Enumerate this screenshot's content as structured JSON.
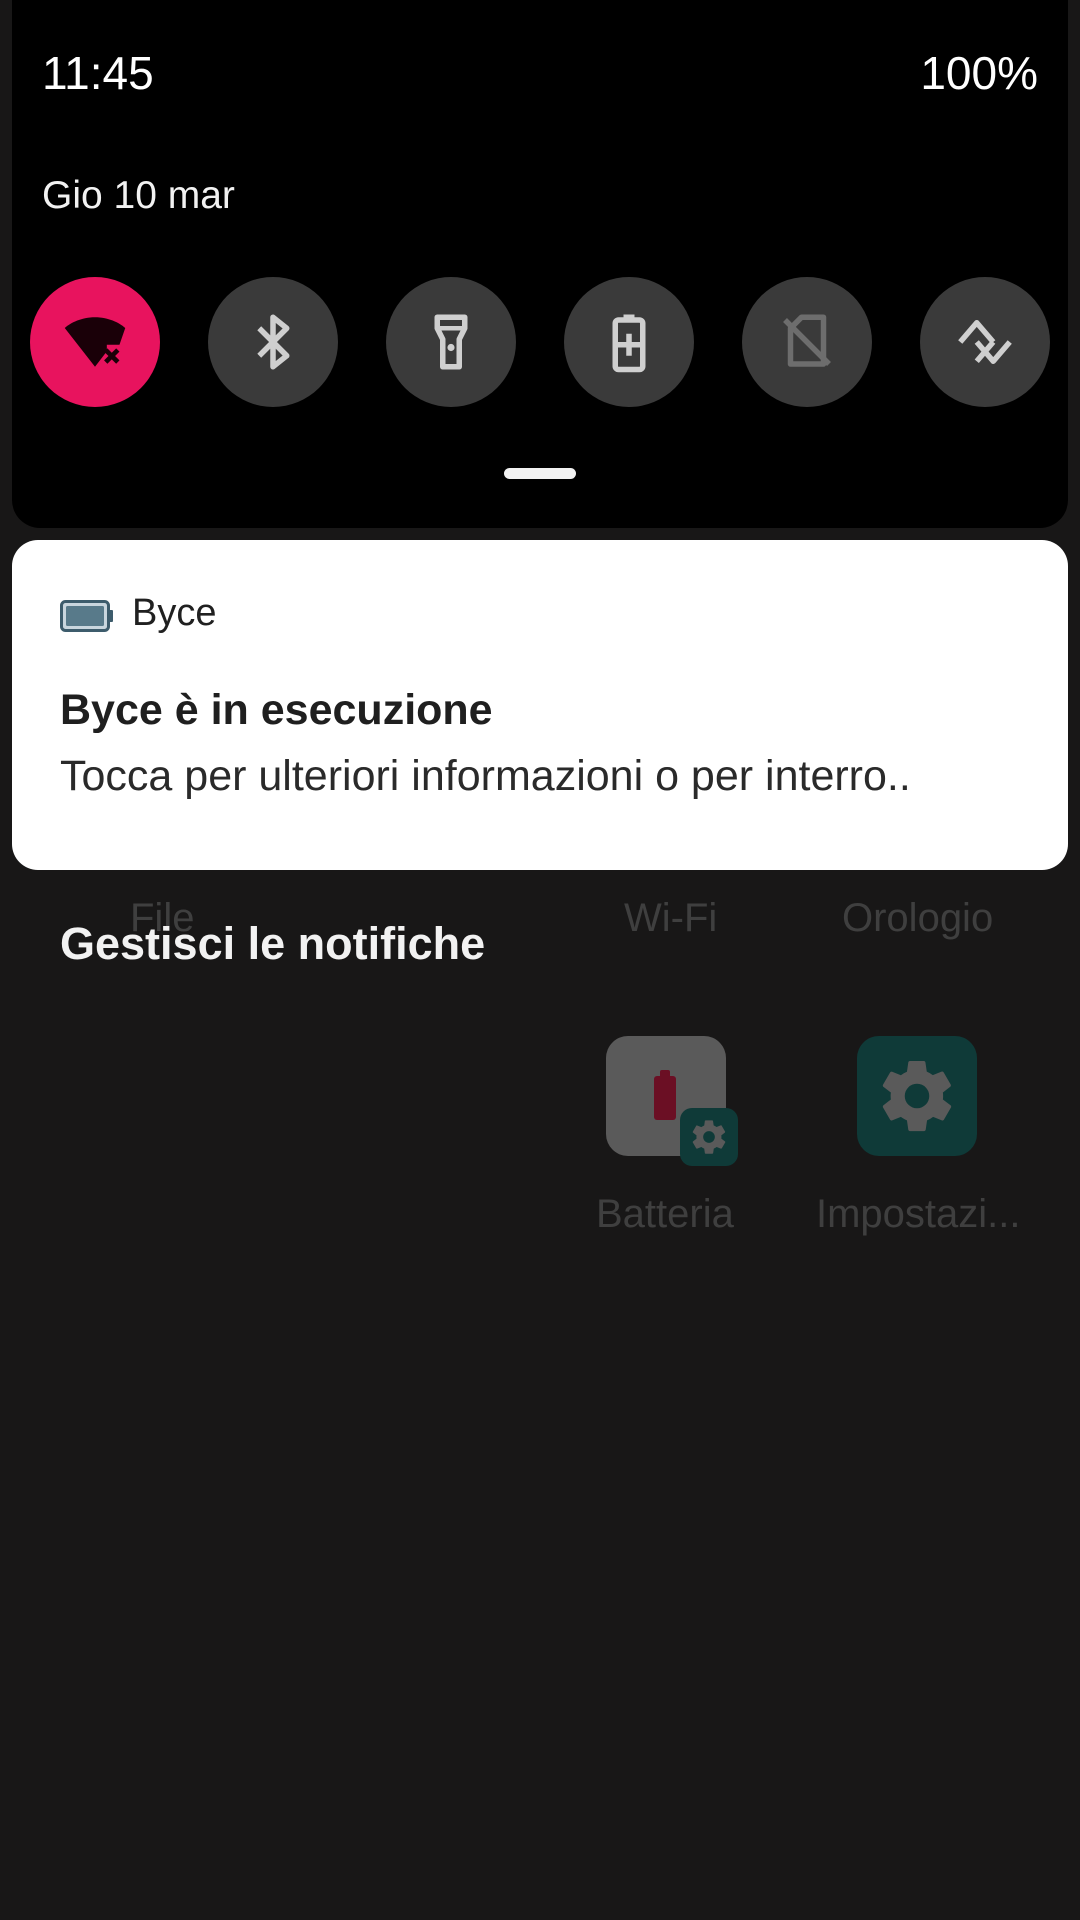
{
  "status_bar": {
    "time": "11:45",
    "battery": "100%"
  },
  "quick_settings": {
    "date": "Gio 10 mar",
    "tiles": [
      {
        "name": "wifi-off",
        "active": true
      },
      {
        "name": "bluetooth",
        "active": false
      },
      {
        "name": "flashlight",
        "active": false
      },
      {
        "name": "battery-saver",
        "active": false
      },
      {
        "name": "no-sim",
        "active": false
      },
      {
        "name": "auto-rotate",
        "active": false
      }
    ],
    "accent_color": "#e8135e"
  },
  "notification": {
    "app_name": "Byce",
    "title": "Byce è in esecuzione",
    "text": "Tocca per ulteriori informazioni o per interro.."
  },
  "manage_label": "Gestisci le notifiche",
  "launcher": {
    "labels": {
      "file": "File",
      "wifi": "Wi-Fi",
      "clock": "Orologio",
      "battery": "Batteria",
      "settings": "Impostazi..."
    }
  }
}
